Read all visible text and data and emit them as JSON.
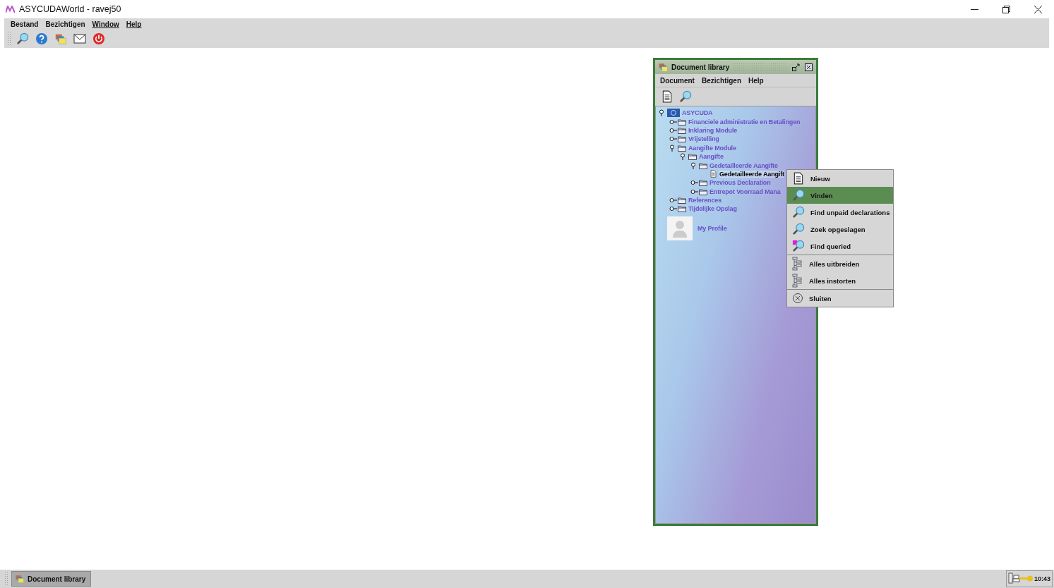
{
  "window": {
    "title": "ASYCUDAWorld - ravej50"
  },
  "menubar": [
    {
      "label": "Bestand",
      "mnemonic": false
    },
    {
      "label": "Bezichtigen",
      "mnemonic": false
    },
    {
      "label": "Window",
      "mnemonic": true
    },
    {
      "label": "Help",
      "mnemonic": true
    }
  ],
  "toolbar": [
    {
      "kind": "search"
    },
    {
      "kind": "help"
    },
    {
      "kind": "folders"
    },
    {
      "kind": "mail"
    },
    {
      "kind": "power"
    }
  ],
  "library": {
    "title": "Document library",
    "menubar": [
      "Document",
      "Bezichtigen",
      "Help"
    ],
    "toolbar": [
      {
        "kind": "document"
      },
      {
        "kind": "search"
      }
    ],
    "tree": [
      {
        "label": "ASYCUDA",
        "kind": "root",
        "expanded": true,
        "selected": false,
        "children": [
          {
            "label": "Financiele administratie en Betalingen",
            "kind": "folder",
            "expanded": false,
            "selected": false
          },
          {
            "label": "Inklaring Module",
            "kind": "folder",
            "expanded": false,
            "selected": false
          },
          {
            "label": "Vrijstelling",
            "kind": "folder",
            "expanded": false,
            "selected": false
          },
          {
            "label": "Aangifte Module",
            "kind": "folder",
            "expanded": true,
            "selected": false,
            "children": [
              {
                "label": "Aangifte",
                "kind": "folder",
                "expanded": true,
                "selected": false,
                "children": [
                  {
                    "label": "Gedetailleerde Aangifte",
                    "kind": "folder",
                    "expanded": true,
                    "selected": false,
                    "children": [
                      {
                        "label": "Gedetailleerde Aangift",
                        "kind": "document",
                        "selected": true
                      }
                    ]
                  },
                  {
                    "label": "Previous Declaration",
                    "kind": "folder",
                    "expanded": false,
                    "selected": false
                  },
                  {
                    "label": "Entrepot Voorraad Mana",
                    "kind": "folder",
                    "expanded": false,
                    "selected": false
                  }
                ]
              }
            ]
          },
          {
            "label": "References",
            "kind": "folder",
            "expanded": false,
            "selected": false
          },
          {
            "label": "Tijdelijke Opslag",
            "kind": "folder",
            "expanded": false,
            "selected": false
          }
        ]
      }
    ],
    "profile": {
      "label": "My Profile"
    }
  },
  "context_menu": [
    [
      {
        "label": "Nieuw",
        "kind": "document",
        "selected": false
      },
      {
        "label": "Vinden",
        "kind": "search",
        "selected": true
      },
      {
        "label": "Find unpaid declarations",
        "kind": "search",
        "selected": false
      },
      {
        "label": "Zoek opgeslagen",
        "kind": "search",
        "selected": false
      },
      {
        "label": "Find queried",
        "kind": "queried",
        "selected": false
      }
    ],
    [
      {
        "label": "Alles uitbreiden",
        "kind": "tree",
        "selected": false
      },
      {
        "label": "Alles instorten",
        "kind": "tree",
        "selected": false
      }
    ],
    [
      {
        "label": "Sluiten",
        "kind": "close",
        "selected": false
      }
    ]
  ],
  "taskbar": {
    "items": [
      {
        "label": "Document library"
      }
    ],
    "clock": "10:43"
  }
}
